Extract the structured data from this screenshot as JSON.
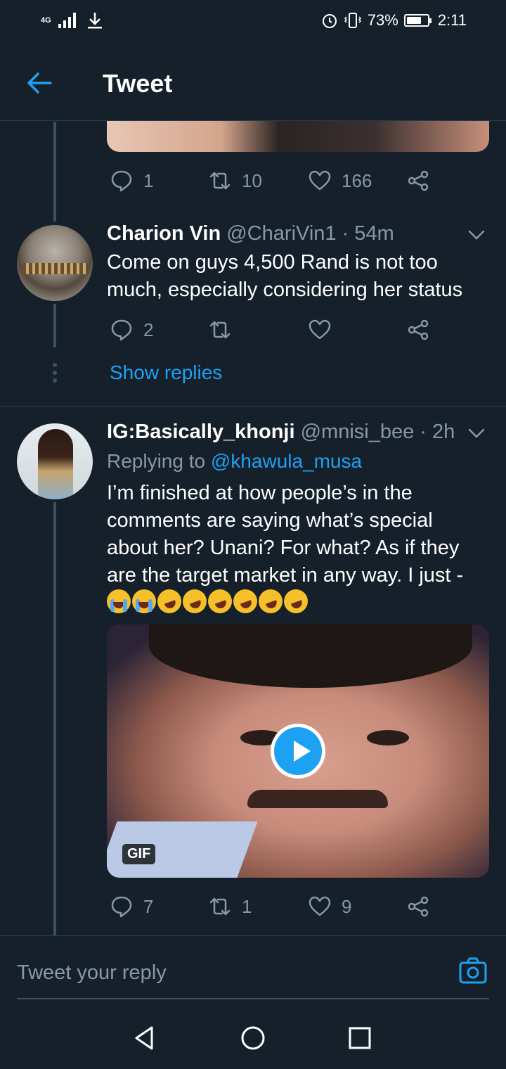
{
  "status_bar": {
    "network": "4G",
    "battery_percent": "73%",
    "battery_level": 0.73,
    "time": "2:11"
  },
  "header": {
    "title": "Tweet"
  },
  "colors": {
    "background": "#15202b",
    "accent": "#1da1f2",
    "muted": "#8899a6"
  },
  "top_tweet": {
    "replies": "1",
    "retweets": "10",
    "likes": "166"
  },
  "reply1": {
    "name": "Charion Vin",
    "meta": "@ChariVin1 · 54m",
    "text": "Come on guys 4,500 Rand is not too much, especially considering her status",
    "replies": "2",
    "retweets": "",
    "likes": "",
    "show_replies": "Show replies"
  },
  "reply2": {
    "name": "IG:Basically_khonji",
    "meta": "@mnisi_bee · 2h",
    "replying_prefix": "Replying to ",
    "replying_handle": "@khawula_musa",
    "text": "I’m finished at how people’s in the comments are saying what’s special about her? Unani? For what? As if they are the target market in any way. I just - �",
    "emojis": [
      "loudly-crying-face",
      "loudly-crying-face",
      "rolling-on-floor-laughing",
      "rolling-on-floor-laughing",
      "rolling-on-floor-laughing",
      "rolling-on-floor-laughing",
      "rolling-on-floor-laughing",
      "rolling-on-floor-laughing"
    ],
    "gif_badge": "GIF",
    "replies": "7",
    "retweets": "1",
    "likes": "9"
  },
  "reply_bar": {
    "placeholder": "Tweet your reply"
  }
}
